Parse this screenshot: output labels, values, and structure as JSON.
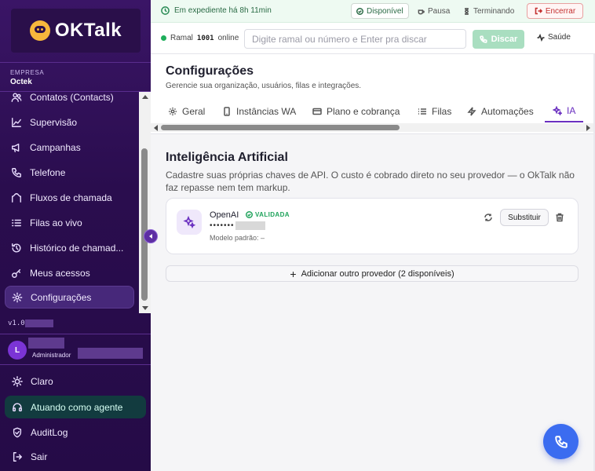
{
  "brand": {
    "name": "OKTalk"
  },
  "company": {
    "label": "EMPRESA",
    "name": "Octek"
  },
  "sidebar": {
    "items": [
      {
        "label": "Contatos (Contacts)",
        "icon": "users-icon"
      },
      {
        "label": "Supervisão",
        "icon": "chart-line-icon"
      },
      {
        "label": "Campanhas",
        "icon": "megaphone-icon"
      },
      {
        "label": "Telefone",
        "icon": "phone-icon"
      },
      {
        "label": "Fluxos de chamada",
        "icon": "workflow-icon"
      },
      {
        "label": "Filas ao vivo",
        "icon": "list-icon"
      },
      {
        "label": "Histórico de chamad...",
        "icon": "history-icon"
      },
      {
        "label": "Meus acessos",
        "icon": "key-icon"
      },
      {
        "label": "Configurações",
        "icon": "gear-icon",
        "active": true
      }
    ],
    "version_prefix": "v1.0",
    "user": {
      "initial": "L",
      "role": "Administrador"
    },
    "footer": [
      {
        "label": "Claro",
        "icon": "sun-icon"
      },
      {
        "label": "Atuando como agente",
        "icon": "headset-icon"
      },
      {
        "label": "AuditLog",
        "icon": "shield-icon"
      },
      {
        "label": "Sair",
        "icon": "logout-icon"
      }
    ]
  },
  "topbar": {
    "shift_text": "Em expediente há 8h 11min",
    "statuses": [
      "Disponível",
      "Pausa",
      "Terminando"
    ],
    "active_status": "Disponível",
    "end_label": "Encerrar"
  },
  "dialbar": {
    "ramal_label": "Ramal",
    "ramal_number": "1001",
    "ramal_status": "online",
    "placeholder": "Digite ramal ou número e Enter pra discar",
    "dial_label": "Discar",
    "health_label": "Saúde"
  },
  "settings": {
    "title": "Configurações",
    "subtitle": "Gerencie sua organização, usuários, filas e integrações.",
    "tabs": [
      {
        "label": "Geral",
        "icon": "gear-icon"
      },
      {
        "label": "Instâncias WA",
        "icon": "smartphone-icon"
      },
      {
        "label": "Plano e cobrança",
        "icon": "credit-card-icon"
      },
      {
        "label": "Filas",
        "icon": "list-icon"
      },
      {
        "label": "Automações",
        "icon": "zap-icon"
      },
      {
        "label": "IA",
        "icon": "sparkles-icon",
        "active": true
      }
    ]
  },
  "ai": {
    "title": "Inteligência Artificial",
    "description": "Cadastre suas próprias chaves de API. O custo é cobrado direto no seu provedor — o OkTalk não faz repasse nem tem markup.",
    "provider": {
      "name": "OpenAI",
      "status": "VALIDADA",
      "masked_key": "•••••••",
      "model_label": "Modelo padrão: –",
      "replace_label": "Substituir"
    },
    "add_label": "Adicionar outro provedor (2 disponíveis)"
  },
  "colors": {
    "accent": "#6a2fc0",
    "sidebar": "#2a0d4e",
    "success": "#1fa35b",
    "danger": "#c43030",
    "fab": "#3b6cf0"
  }
}
